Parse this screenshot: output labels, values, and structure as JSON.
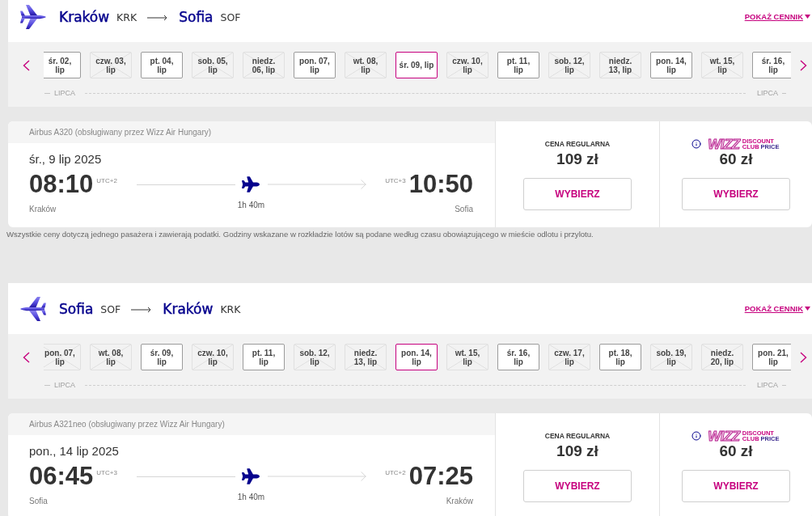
{
  "flights": [
    {
      "kind": "outbound",
      "route": {
        "origin_city": "Kraków",
        "origin_code": "KRK",
        "destination_city": "Sofia",
        "destination_code": "SOF"
      },
      "price_list_link": "POKAŻ CENNIK",
      "dates": [
        {
          "label": "śr. 02, lip",
          "disabled": false,
          "selected": false
        },
        {
          "label": "czw. 03, lip",
          "disabled": true,
          "selected": false
        },
        {
          "label": "pt. 04, lip",
          "disabled": false,
          "selected": false
        },
        {
          "label": "sob. 05, lip",
          "disabled": true,
          "selected": false
        },
        {
          "label": "niedz. 06, lip",
          "disabled": true,
          "selected": false
        },
        {
          "label": "pon. 07, lip",
          "disabled": false,
          "selected": false
        },
        {
          "label": "wt. 08, lip",
          "disabled": true,
          "selected": false
        },
        {
          "label": "śr. 09, lip",
          "disabled": false,
          "selected": true
        },
        {
          "label": "czw. 10, lip",
          "disabled": true,
          "selected": false
        },
        {
          "label": "pt. 11, lip",
          "disabled": false,
          "selected": false
        },
        {
          "label": "sob. 12, lip",
          "disabled": true,
          "selected": false
        },
        {
          "label": "niedz. 13, lip",
          "disabled": true,
          "selected": false
        },
        {
          "label": "pon. 14, lip",
          "disabled": false,
          "selected": false
        },
        {
          "label": "wt. 15, lip",
          "disabled": true,
          "selected": false
        },
        {
          "label": "śr. 16, lip",
          "disabled": false,
          "selected": false
        }
      ],
      "month_labels": [
        "LIPCA",
        "LIPCA"
      ],
      "flight": {
        "aircraft": "Airbus A320 (obsługiwany przez Wizz Air Hungary)",
        "date": "śr., 9 lip 2025",
        "departure": {
          "time": "08:10",
          "utc": "UTC+2",
          "city": "Kraków"
        },
        "duration": "1h 40m",
        "arrival": {
          "time": "10:50",
          "utc": "UTC+3",
          "city": "Sofia"
        }
      },
      "fares": [
        {
          "kind": "regular",
          "label": "CENA REGULARNA",
          "price": "109 zł",
          "button": "WYBIERZ"
        },
        {
          "kind": "club",
          "logo": {
            "wordmark": "WIZZ",
            "tagline": [
              {
                "text": "DISCOUNT",
                "color": "#c6007e"
              },
              {
                "text": "CLUB",
                "color": "#c6007e"
              },
              {
                "text": "PRICE",
                "color": "#3b2a8f"
              }
            ]
          },
          "price": "60 zł",
          "button": "WYBIERZ"
        }
      ],
      "note": "Wszystkie ceny dotyczą jednego pasażera i zawierają podatki. Godziny wskazane w rozkładzie lotów są podane według czasu obowiązującego w mieście odlotu i przylotu."
    },
    {
      "kind": "return",
      "route": {
        "origin_city": "Sofia",
        "origin_code": "SOF",
        "destination_city": "Kraków",
        "destination_code": "KRK"
      },
      "price_list_link": "POKAŻ CENNIK",
      "dates": [
        {
          "label": "pon. 07, lip",
          "disabled": true,
          "selected": false
        },
        {
          "label": "wt. 08, lip",
          "disabled": true,
          "selected": false
        },
        {
          "label": "śr. 09, lip",
          "disabled": false,
          "selected": false
        },
        {
          "label": "czw. 10, lip",
          "disabled": true,
          "selected": false
        },
        {
          "label": "pt. 11, lip",
          "disabled": false,
          "selected": false
        },
        {
          "label": "sob. 12, lip",
          "disabled": true,
          "selected": false
        },
        {
          "label": "niedz. 13, lip",
          "disabled": true,
          "selected": false
        },
        {
          "label": "pon. 14, lip",
          "disabled": false,
          "selected": true
        },
        {
          "label": "wt. 15, lip",
          "disabled": true,
          "selected": false
        },
        {
          "label": "śr. 16, lip",
          "disabled": false,
          "selected": false
        },
        {
          "label": "czw. 17, lip",
          "disabled": true,
          "selected": false
        },
        {
          "label": "pt. 18, lip",
          "disabled": false,
          "selected": false
        },
        {
          "label": "sob. 19, lip",
          "disabled": true,
          "selected": false
        },
        {
          "label": "niedz. 20, lip",
          "disabled": true,
          "selected": false
        },
        {
          "label": "pon. 21, lip",
          "disabled": false,
          "selected": false
        }
      ],
      "month_labels": [
        "LIPCA",
        "LIPCA"
      ],
      "flight": {
        "aircraft": "Airbus A321neo (obsługiwany przez Wizz Air Hungary)",
        "date": "pon., 14 lip 2025",
        "departure": {
          "time": "06:45",
          "utc": "UTC+3",
          "city": "Sofia"
        },
        "duration": "1h 40m",
        "arrival": {
          "time": "07:25",
          "utc": "UTC+2",
          "city": "Kraków"
        }
      },
      "fares": [
        {
          "kind": "regular",
          "label": "CENA REGULARNA",
          "price": "109 zł",
          "button": "WYBIERZ"
        },
        {
          "kind": "club",
          "logo": {
            "wordmark": "WIZZ",
            "tagline": [
              {
                "text": "DISCOUNT",
                "color": "#c6007e"
              },
              {
                "text": "CLUB",
                "color": "#c6007e"
              },
              {
                "text": "PRICE",
                "color": "#3b2a8f"
              }
            ]
          },
          "price": "60 zł",
          "button": "WYBIERZ"
        }
      ]
    }
  ]
}
